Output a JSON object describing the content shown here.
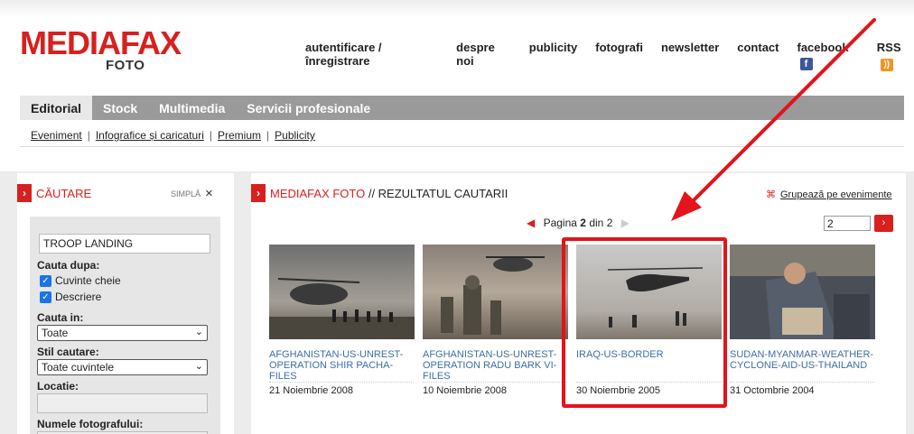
{
  "logo": {
    "main": "MEDIAFAX",
    "sub": "FOTO"
  },
  "topnav": {
    "items": [
      "autentificare / înregistrare",
      "despre noi",
      "publicity",
      "fotografi",
      "newsletter",
      "contact"
    ],
    "facebook": "facebook",
    "rss": "RSS"
  },
  "maintabs": [
    "Editorial",
    "Stock",
    "Multimedia",
    "Servicii profesionale"
  ],
  "subtabs": [
    "Eveniment",
    "Infografice și caricaturi",
    "Premium",
    "Publicity"
  ],
  "search": {
    "title": "CĂUTARE",
    "mode": "SIMPLĂ",
    "close": "×",
    "query": "TROOP LANDING",
    "search_by_label": "Cauta dupa:",
    "check_keywords": "Cuvinte cheie",
    "check_description": "Descriere",
    "search_in_label": "Cauta in:",
    "search_in_value": "Toate",
    "style_label": "Stil cautare:",
    "style_value": "Toate cuvintele",
    "location_label": "Locatie:",
    "photographer_label": "Numele fotografului:"
  },
  "results": {
    "title_brand": "MEDIAFAX FOTO",
    "title_rest": " // REZULTATUL CAUTARII",
    "group_label": "Grupează pe evenimente",
    "pager_label": "Pagina",
    "pager_current": "2",
    "pager_of": "din",
    "pager_total": "2",
    "page_input": "2",
    "cards": [
      {
        "title": "AFGHANISTAN-US-UNREST-OPERATION SHIR PACHA-FILES",
        "date": "21 Noiembrie 2008"
      },
      {
        "title": "AFGHANISTAN-US-UNREST-OPERATION RADU BARK VI-FILES",
        "date": "10 Noiembrie 2008"
      },
      {
        "title": "IRAQ-US-BORDER",
        "date": "30 Noiembrie 2005"
      },
      {
        "title": "SUDAN-MYANMAR-WEATHER-CYCLONE-AID-US-THAILAND",
        "date": "31 Octombrie 2004"
      }
    ]
  },
  "colors": {
    "brand_red": "#d8201e",
    "annotation_red": "#e3141b",
    "tab_gray": "#9a9a9a",
    "link_blue": "#3a6ea5"
  }
}
